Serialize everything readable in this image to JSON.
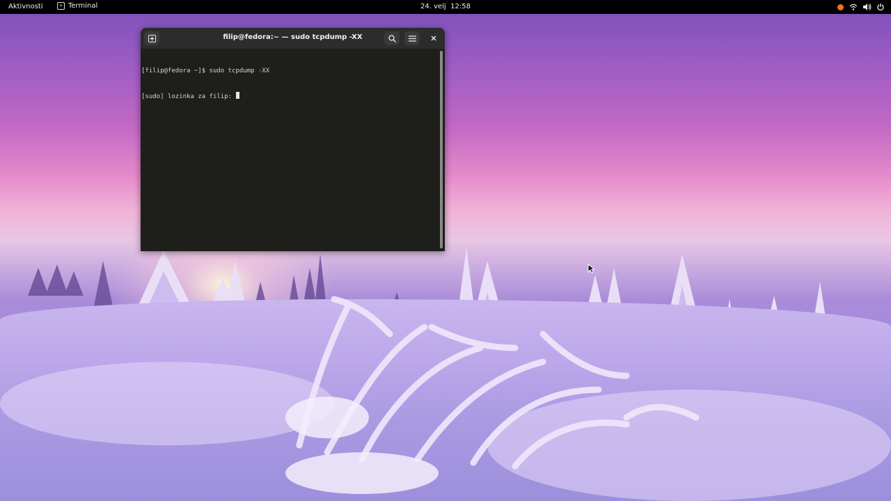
{
  "topbar": {
    "activities_label": "Aktivnosti",
    "app_name": "Terminal",
    "app_icon": "terminal-icon",
    "clock": "24. velj  12:58",
    "tray_icons": [
      "notification-dot-icon",
      "wifi-icon",
      "volume-icon",
      "power-icon"
    ],
    "notification_color": "#f07316"
  },
  "terminal_window": {
    "title": "filip@fedora:~ — sudo tcpdump -XX",
    "buttons": [
      "new-tab-icon",
      "search-icon",
      "hamburger-menu-icon",
      "close-icon"
    ],
    "lines": [
      "[filip@fedora ~]$ sudo tcpdump -XX",
      "[sudo] lozinka za filip: "
    ],
    "background_color": "#1e1e1b",
    "titlebar_color": "#2c2c2c"
  },
  "desktop": {
    "wallpaper": "snowy-forest-sunset",
    "pointer": "arrow-cursor"
  }
}
